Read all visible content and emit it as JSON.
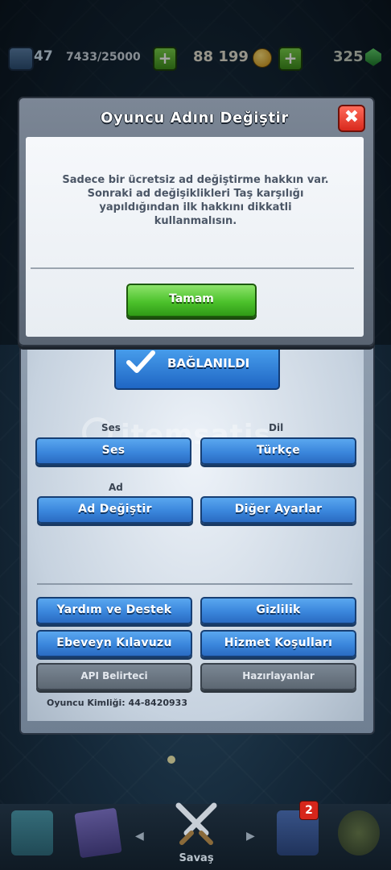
{
  "topbar": {
    "level": "47",
    "xp_progress": "7433/25000",
    "gold": "88 199",
    "gems": "325"
  },
  "settings": {
    "connected_label": "BAĞLANILDI",
    "sound_section": "Ses",
    "sound_button": "Ses",
    "language_section": "Dil",
    "language_button": "Türkçe",
    "name_section": "Ad",
    "change_name_button": "Ad Değiştir",
    "other_settings_button": "Diğer Ayarlar",
    "help_button": "Yardım ve Destek",
    "privacy_button": "Gizlilik",
    "parents_guide_button": "Ebeveyn Kılavuzu",
    "terms_button": "Hizmet Koşulları",
    "api_token_button": "API Belirteci",
    "credits_button": "Hazırlayanlar",
    "player_id": "Oyuncu Kimliği: 44-8420933"
  },
  "modal": {
    "title": "Oyuncu Adını Değiştir",
    "close_symbol": "✖",
    "message": "Sadece bir ücretsiz ad değiştirme hakkın var. Sonraki ad değişiklikleri Taş karşılığı yapıldığından ilk hakkını dikkatli kullanmalısın.",
    "ok_button": "Tamam"
  },
  "watermark": "itemsatis",
  "nav": {
    "battle_label": "Savaş",
    "clan_badge_count": "2"
  },
  "colors": {
    "primary_button": "#3a86dc",
    "ok_button": "#4cc22c",
    "close_button": "#d8291d",
    "disabled_button": "#6b7682"
  },
  "icons": {
    "close": "close-icon",
    "check": "check-icon",
    "plus": "plus-icon",
    "coin": "gold-coin-icon",
    "gem": "gem-icon",
    "battle": "crossed-swords-icon"
  }
}
